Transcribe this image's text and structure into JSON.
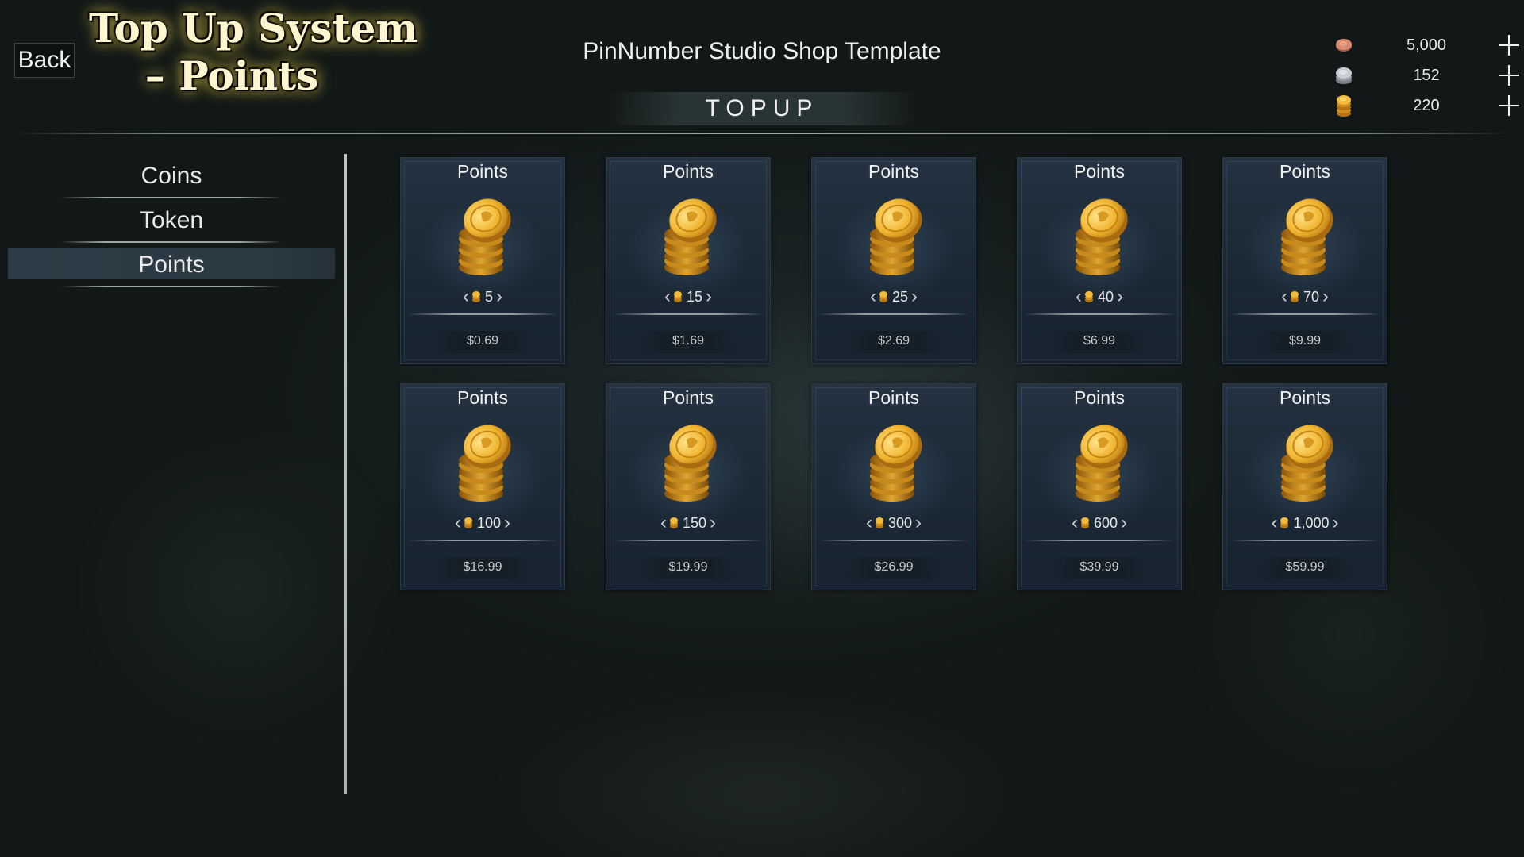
{
  "header": {
    "back_label": "Back",
    "logo_line1": "Top Up System",
    "logo_line2": "– Points",
    "shop_title": "PinNumber Studio Shop Template",
    "section_label": "TOPUP"
  },
  "currencies": [
    {
      "icon": "copper-coin-icon",
      "value": "5,000",
      "color": "#d0836a"
    },
    {
      "icon": "silver-coin-icon",
      "value": "152",
      "color": "#b8bcc4"
    },
    {
      "icon": "gold-coin-stack-icon",
      "value": "220",
      "color": "#e3a52a"
    }
  ],
  "sidebar": {
    "items": [
      {
        "label": "Coins",
        "active": false
      },
      {
        "label": "Token",
        "active": false
      },
      {
        "label": "Points",
        "active": true
      }
    ]
  },
  "products": [
    {
      "title": "Points",
      "qty": "5",
      "price": "$0.69"
    },
    {
      "title": "Points",
      "qty": "15",
      "price": "$1.69"
    },
    {
      "title": "Points",
      "qty": "25",
      "price": "$2.69"
    },
    {
      "title": "Points",
      "qty": "40",
      "price": "$6.99"
    },
    {
      "title": "Points",
      "qty": "70",
      "price": "$9.99"
    },
    {
      "title": "Points",
      "qty": "100",
      "price": "$16.99"
    },
    {
      "title": "Points",
      "qty": "150",
      "price": "$19.99"
    },
    {
      "title": "Points",
      "qty": "300",
      "price": "$26.99"
    },
    {
      "title": "Points",
      "qty": "600",
      "price": "$39.99"
    },
    {
      "title": "Points",
      "qty": "1,000",
      "price": "$59.99"
    }
  ]
}
